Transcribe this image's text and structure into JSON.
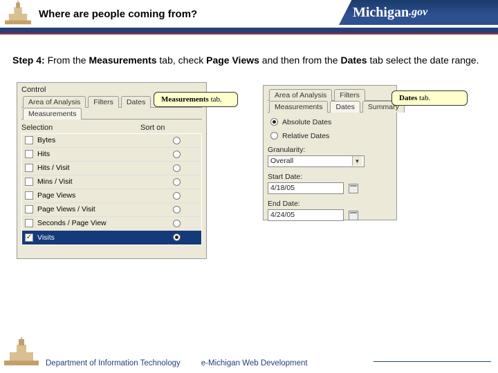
{
  "header": {
    "title": "Where are people coming from?",
    "banner_main": "Michigan",
    "banner_suffix": ".gov"
  },
  "step": {
    "label": "Step 4:",
    "t1": " From the ",
    "b1": "Measurements",
    "t2": " tab, check ",
    "b2": "Page Views",
    "t3": " and then from the ",
    "b3": "Dates",
    "t4": " tab select the date range."
  },
  "left_panel": {
    "group": "Control",
    "tabs": [
      "Area of Analysis",
      "Filters",
      "Dates"
    ],
    "active_tab": "Measurements",
    "col1": "Selection",
    "col2": "Sort on",
    "rows": [
      {
        "label": "Bytes",
        "checked": false,
        "radio": false
      },
      {
        "label": "Hits",
        "checked": false,
        "radio": false
      },
      {
        "label": "Hits / Visit",
        "checked": false,
        "radio": false
      },
      {
        "label": "Mins / Visit",
        "checked": false,
        "radio": false
      },
      {
        "label": "Page Views",
        "checked": false,
        "radio": false
      },
      {
        "label": "Page Views / Visit",
        "checked": false,
        "radio": false
      },
      {
        "label": "Seconds / Page View",
        "checked": false,
        "radio": false
      },
      {
        "label": "Visits",
        "checked": true,
        "radio": true
      }
    ]
  },
  "right_panel": {
    "tabs": [
      "Area of Analysis",
      "Filters",
      "Dates",
      "Summary"
    ],
    "tabs2": [
      "Measurements"
    ],
    "opt_abs": "Absolute Dates",
    "opt_rel": "Relative Dates",
    "gran_label": "Granularity:",
    "gran_value": "Overall",
    "start_label": "Start Date:",
    "start_value": "4/18/05",
    "end_label": "End Date:",
    "end_value": "4/24/05"
  },
  "callouts": {
    "c1a": "Measurements",
    "c1b": " tab.",
    "c2a": "Dates",
    "c2b": " tab."
  },
  "footer": {
    "dept": "Department of Information Technology",
    "group": "e-Michigan Web Development"
  }
}
